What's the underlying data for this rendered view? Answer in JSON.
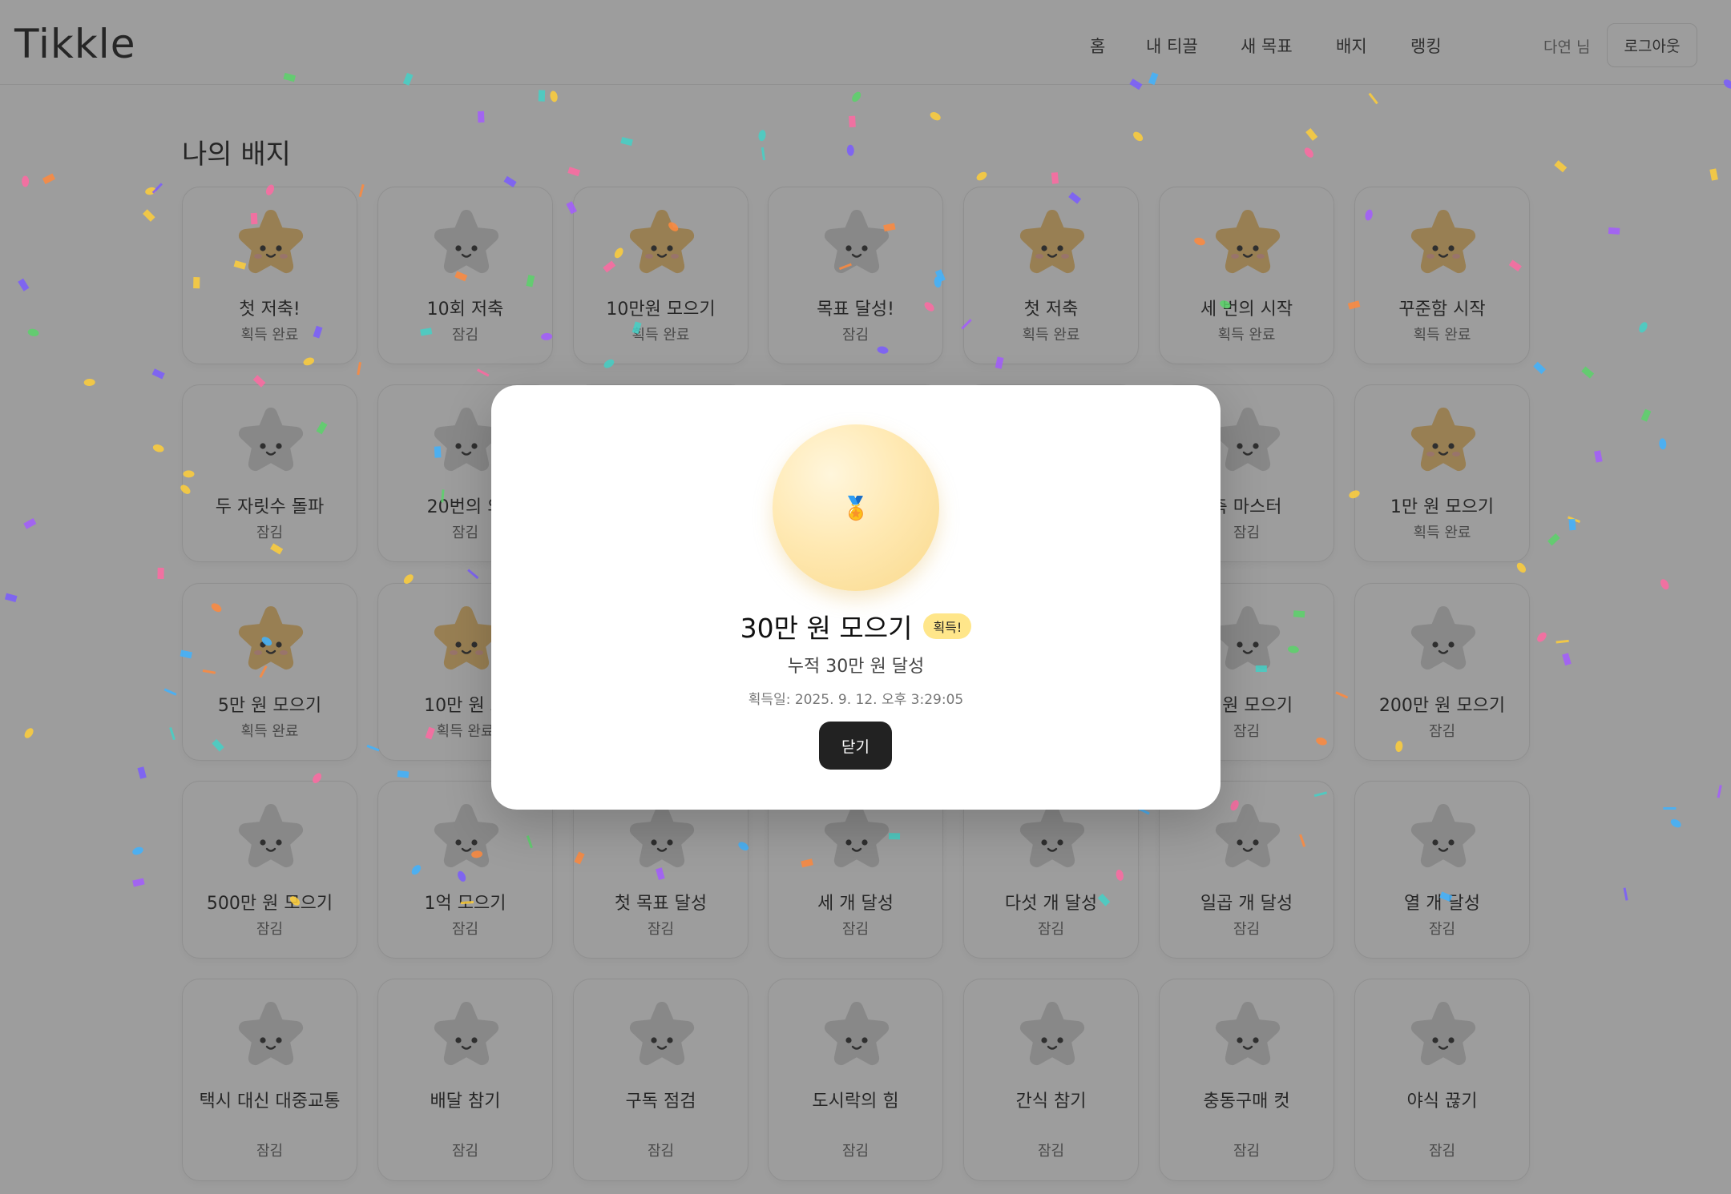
{
  "app": {
    "logo": "Tikkle"
  },
  "nav": {
    "items": [
      {
        "label": "홈"
      },
      {
        "label": "내 티끌"
      },
      {
        "label": "새 목표"
      },
      {
        "label": "배지"
      },
      {
        "label": "랭킹"
      }
    ],
    "user_name": "다연 님",
    "logout_label": "로그아웃"
  },
  "page": {
    "title": "나의 배지"
  },
  "badges": [
    {
      "name": "첫 저축!",
      "status": "획득 완료",
      "earned": true
    },
    {
      "name": "10회 저축",
      "status": "잠김",
      "earned": false
    },
    {
      "name": "10만원 모으기",
      "status": "획득 완료",
      "earned": true
    },
    {
      "name": "목표 달성!",
      "status": "잠김",
      "earned": false
    },
    {
      "name": "첫 저축",
      "status": "획득 완료",
      "earned": true
    },
    {
      "name": "세 번의 시작",
      "status": "획득 완료",
      "earned": true
    },
    {
      "name": "꾸준함 시작",
      "status": "획득 완료",
      "earned": true
    },
    {
      "name": "두 자릿수 돌파",
      "status": "잠김",
      "earned": false
    },
    {
      "name": "20번의 의",
      "status": "잠김",
      "earned": false
    },
    {
      "name": "",
      "status": "",
      "earned": false
    },
    {
      "name": "",
      "status": "",
      "earned": false
    },
    {
      "name": "",
      "status": "",
      "earned": false
    },
    {
      "name": "축 마스터",
      "status": "잠김",
      "earned": false
    },
    {
      "name": "1만 원 모으기",
      "status": "획득 완료",
      "earned": true
    },
    {
      "name": "5만 원 모으기",
      "status": "획득 완료",
      "earned": true
    },
    {
      "name": "10만 원 모",
      "status": "획득 완료",
      "earned": true
    },
    {
      "name": "",
      "status": "",
      "earned": false
    },
    {
      "name": "",
      "status": "",
      "earned": false
    },
    {
      "name": "",
      "status": "",
      "earned": false
    },
    {
      "name": "만 원 모으기",
      "status": "잠김",
      "earned": false
    },
    {
      "name": "200만 원 모으기",
      "status": "잠김",
      "earned": false
    },
    {
      "name": "500만 원 모으기",
      "status": "잠김",
      "earned": false
    },
    {
      "name": "1억 모으기",
      "status": "잠김",
      "earned": false
    },
    {
      "name": "첫 목표 달성",
      "status": "잠김",
      "earned": false
    },
    {
      "name": "세 개 달성",
      "status": "잠김",
      "earned": false
    },
    {
      "name": "다섯 개 달성",
      "status": "잠김",
      "earned": false
    },
    {
      "name": "일곱 개 달성",
      "status": "잠김",
      "earned": false
    },
    {
      "name": "열 개 달성",
      "status": "잠김",
      "earned": false
    },
    {
      "name": "택시 대신 대중교통",
      "status": "잠김",
      "earned": false
    },
    {
      "name": "배달 참기",
      "status": "잠김",
      "earned": false
    },
    {
      "name": "구독 점검",
      "status": "잠김",
      "earned": false
    },
    {
      "name": "도시락의 힘",
      "status": "잠김",
      "earned": false
    },
    {
      "name": "간식 참기",
      "status": "잠김",
      "earned": false
    },
    {
      "name": "충동구매 컷",
      "status": "잠김",
      "earned": false
    },
    {
      "name": "야식 끊기",
      "status": "잠김",
      "earned": false
    }
  ],
  "modal": {
    "icon": "medal-icon",
    "title": "30만 원 모으기",
    "earned_chip": "획득!",
    "description": "누적 30만 원 달성",
    "earned_date": "획득일: 2025. 9. 12. 오후 3:29:05",
    "close_label": "닫기"
  },
  "colors": {
    "star_earned": "#f5c26b",
    "star_locked": "#d4d4d4",
    "overlay": "#3c3c3c",
    "chip": "#ffe68a",
    "close_button": "#222222"
  }
}
